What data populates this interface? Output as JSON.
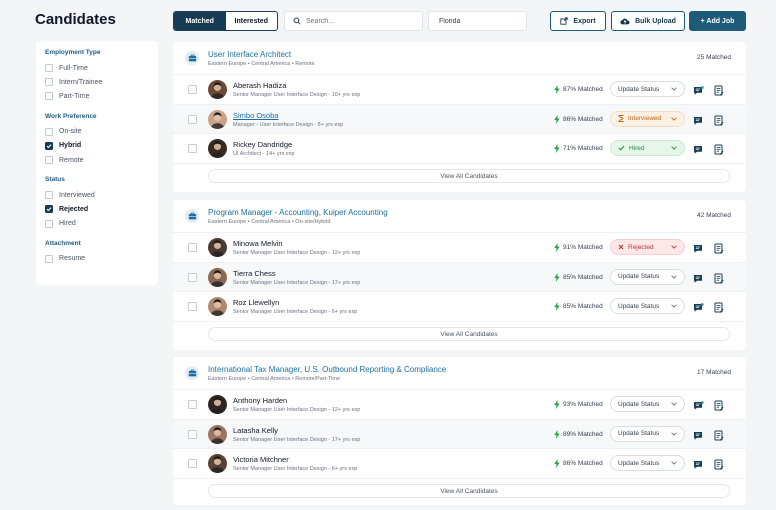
{
  "page": {
    "title": "Candidates"
  },
  "toolbar": {
    "tabs": [
      {
        "label": "Matched",
        "active": true
      },
      {
        "label": "Interested",
        "active": false
      }
    ],
    "search_placeholder": "Search...",
    "location_value": "Florida",
    "export_label": "Export",
    "bulk_upload_label": "Bulk Upload",
    "add_job_label": "+ Add Job"
  },
  "filters": [
    {
      "title": "Employment Type",
      "options": [
        {
          "label": "Full-Time",
          "checked": false
        },
        {
          "label": "Intern/Trainee",
          "checked": false
        },
        {
          "label": "Part-Time",
          "checked": false
        }
      ]
    },
    {
      "title": "Work Preference",
      "options": [
        {
          "label": "On-site",
          "checked": false
        },
        {
          "label": "Hybrid",
          "checked": true
        },
        {
          "label": "Remote",
          "checked": false
        }
      ]
    },
    {
      "title": "Status",
      "options": [
        {
          "label": "Interviewed",
          "checked": false
        },
        {
          "label": "Rejected",
          "checked": true
        },
        {
          "label": "Hired",
          "checked": false
        }
      ]
    },
    {
      "title": "Attachment",
      "options": [
        {
          "label": "Resume",
          "checked": false
        }
      ]
    }
  ],
  "jobs": [
    {
      "title": "User Interface Architect",
      "subtitle": "Eastern Europe • Central America • Remote",
      "matched": "25 Matched",
      "view_all": "View All Candidates",
      "candidates": [
        {
          "name": "Aberash Hadiza",
          "role": "Senior Manager User Interface Design - 10+ yrs exp",
          "match": "87% Matched",
          "status": "Update Status",
          "status_type": "update"
        },
        {
          "name": "Simbo Osoba",
          "role": "Manager - User Interface Design - 8+ yrs exp",
          "match": "86% Matched",
          "status": "Interviewed",
          "status_type": "interviewed"
        },
        {
          "name": "Rickey Dandridge",
          "role": "UI Architect - 14+ yrs exp",
          "match": "71% Matched",
          "status": "Hired",
          "status_type": "hired"
        }
      ]
    },
    {
      "title": "Program Manager - Accounting, Kuiper Accounting",
      "subtitle": "Eastern Europe • Central America • On-site/Hybrid",
      "matched": "42 Matched",
      "view_all": "View All Candidates",
      "candidates": [
        {
          "name": "Minowa Melvin",
          "role": "Senior Manager User Interface Design - 12+ yrs exp",
          "match": "91% Matched",
          "status": "Rejected",
          "status_type": "rejected"
        },
        {
          "name": "Tierra Chess",
          "role": "Senior Manager User Interface Design - 17+ yrs exp",
          "match": "85% Matched",
          "status": "Update Status",
          "status_type": "update"
        },
        {
          "name": "Roz Llewellyn",
          "role": "Senior Manager User Interface Design - 6+ yrs exp",
          "match": "85% Matched",
          "status": "Update Status",
          "status_type": "update"
        }
      ]
    },
    {
      "title": "International Tax Manager, U.S. Outbound Reporting & Compliance",
      "subtitle": "Eastern Europe • Central America • Remote/Part-Time",
      "matched": "17 Matched",
      "view_all": "View All Candidates",
      "candidates": [
        {
          "name": "Anthony Harden",
          "role": "Senior Manager User Interface Design - 12+ yrs exp",
          "match": "93% Matched",
          "status": "Update Status",
          "status_type": "update"
        },
        {
          "name": "Latasha Kelly",
          "role": "Senior Manager User Interface Design - 17+ yrs exp",
          "match": "89% Matched",
          "status": "Update Status",
          "status_type": "update"
        },
        {
          "name": "Victoria Mitchner",
          "role": "Senior Manager User Interface Design - 6+ yrs exp",
          "match": "86% Matched",
          "status": "Update Status",
          "status_type": "update"
        }
      ]
    }
  ],
  "colors": {
    "brand": "#173b52",
    "link": "#1e6fa0",
    "match_bolt": "#22a447"
  }
}
